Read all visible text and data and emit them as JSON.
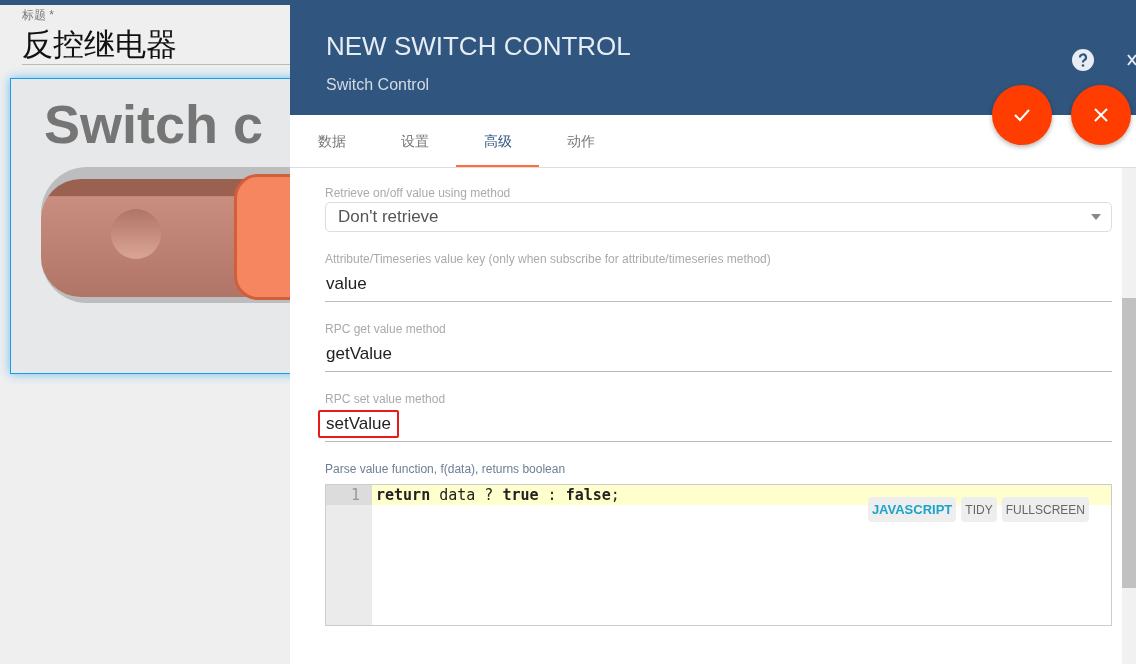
{
  "title_field": {
    "label": "标题 *",
    "value": "反控继电器"
  },
  "widget_preview": {
    "heading": "Switch c",
    "switch_on": false
  },
  "dialog": {
    "title": "NEW SWITCH CONTROL",
    "subtitle": "Switch Control",
    "tabs": [
      {
        "label": "数据",
        "selected": false
      },
      {
        "label": "设置",
        "selected": false
      },
      {
        "label": "高级",
        "selected": true
      },
      {
        "label": "动作",
        "selected": false
      }
    ],
    "fields": [
      {
        "kind": "select",
        "label": "Retrieve on/off value using method",
        "value": "Don't retrieve"
      },
      {
        "kind": "text",
        "label": "Attribute/Timeseries value key (only when subscribe for attribute/timeseries method)",
        "value": "value",
        "highlighted": false
      },
      {
        "kind": "text",
        "label": "RPC get value method",
        "value": "getValue",
        "highlighted": false
      },
      {
        "kind": "text",
        "label": "RPC set value method",
        "value": "setValue",
        "highlighted": true
      }
    ],
    "editor": {
      "label": "Parse value function, f(data), returns boolean",
      "lines": [
        {
          "number": "1",
          "code": "**return** data ? **true** : **false**;"
        }
      ],
      "buttons": [
        {
          "label": "JAVASCRIPT",
          "selected": true
        },
        {
          "label": "TIDY",
          "selected": false
        },
        {
          "label": "FULLSCREEN",
          "selected": false
        }
      ]
    }
  }
}
